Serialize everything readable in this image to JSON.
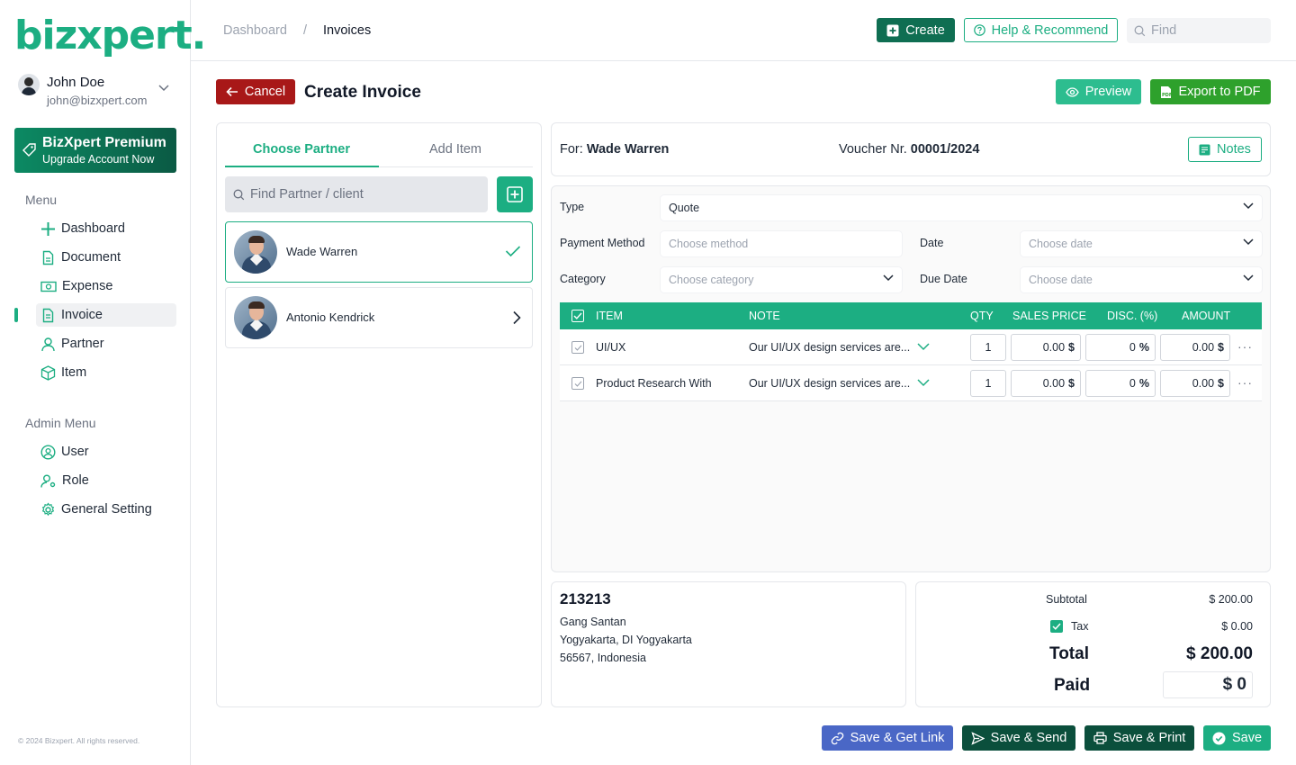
{
  "brand": {
    "logo": "bizxpert.",
    "accent": "#1cae82"
  },
  "user": {
    "name": "John Doe",
    "email": "john@bizxpert.com"
  },
  "premium": {
    "title": "BizXpert Premium",
    "subtitle": "Upgrade Account Now"
  },
  "menu": {
    "heading": "Menu",
    "items": [
      {
        "label": "Dashboard",
        "icon": "plus-grid-icon"
      },
      {
        "label": "Document",
        "icon": "document-icon"
      },
      {
        "label": "Expense",
        "icon": "cash-icon"
      },
      {
        "label": "Invoice",
        "icon": "invoice-icon",
        "active": true
      },
      {
        "label": "Partner",
        "icon": "person-icon"
      },
      {
        "label": "Item",
        "icon": "box-icon"
      }
    ]
  },
  "admin_menu": {
    "heading": "Admin Menu",
    "items": [
      {
        "label": "User",
        "icon": "user-circle-icon"
      },
      {
        "label": "Role",
        "icon": "user-gear-icon"
      },
      {
        "label": "General Setting",
        "icon": "gear-icon"
      }
    ]
  },
  "copyright": "© 2024 Bizxpert. All rights reserved.",
  "breadcrumb": {
    "root": "Dashboard",
    "separator": "/",
    "current": "Invoices"
  },
  "header": {
    "create": "Create",
    "help": "Help & Recommend",
    "find_placeholder": "Find"
  },
  "page": {
    "cancel": "Cancel",
    "title": "Create Invoice",
    "preview": "Preview",
    "export": "Export to PDF"
  },
  "partner_panel": {
    "tabs": [
      "Choose Partner",
      "Add Item"
    ],
    "search_placeholder": "Find Partner / client",
    "partners": [
      {
        "name": "Wade Warren",
        "selected": true
      },
      {
        "name": "Antonio Kendrick",
        "selected": false
      }
    ]
  },
  "invoice": {
    "for_label": "For:",
    "for_name": "Wade Warren",
    "voucher_label": "Voucher Nr.",
    "voucher_number": "00001/2024",
    "notes": "Notes"
  },
  "form": {
    "type_label": "Type",
    "type_value": "Quote",
    "payment_label": "Payment Method",
    "payment_placeholder": "Choose method",
    "date_label": "Date",
    "date_placeholder": "Choose date",
    "category_label": "Category",
    "category_placeholder": "Choose category",
    "due_label": "Due Date",
    "due_placeholder": "Choose date"
  },
  "table": {
    "headers": {
      "item": "ITEM",
      "note": "NOTE",
      "qty": "QTY",
      "price": "SALES PRICE",
      "disc": "DISC. (%)",
      "amount": "AMOUNT"
    },
    "rows": [
      {
        "item": "UI/UX",
        "note": "Our UI/UX design services are...",
        "qty": "1",
        "price": "0.00",
        "disc": "0",
        "amount": "0.00"
      },
      {
        "item": "Product Research With",
        "note": "Our UI/UX design services are...",
        "qty": "1",
        "price": "0.00",
        "disc": "0",
        "amount": "0.00"
      }
    ],
    "currency_symbol": "$",
    "percent_symbol": "%"
  },
  "address": {
    "code": "213213",
    "line1": "Gang Santan",
    "line2": "Yogyakarta, DI Yogyakarta",
    "line3": "56567, Indonesia"
  },
  "summary": {
    "subtotal_label": "Subtotal",
    "subtotal": "$ 200.00",
    "tax_label": "Tax",
    "tax": "$ 0.00",
    "total_label": "Total",
    "total": "$ 200.00",
    "paid_label": "Paid",
    "paid": "$ 0"
  },
  "actions": {
    "link": "Save & Get Link",
    "send": "Save & Send",
    "print": "Save & Print",
    "save": "Save"
  }
}
